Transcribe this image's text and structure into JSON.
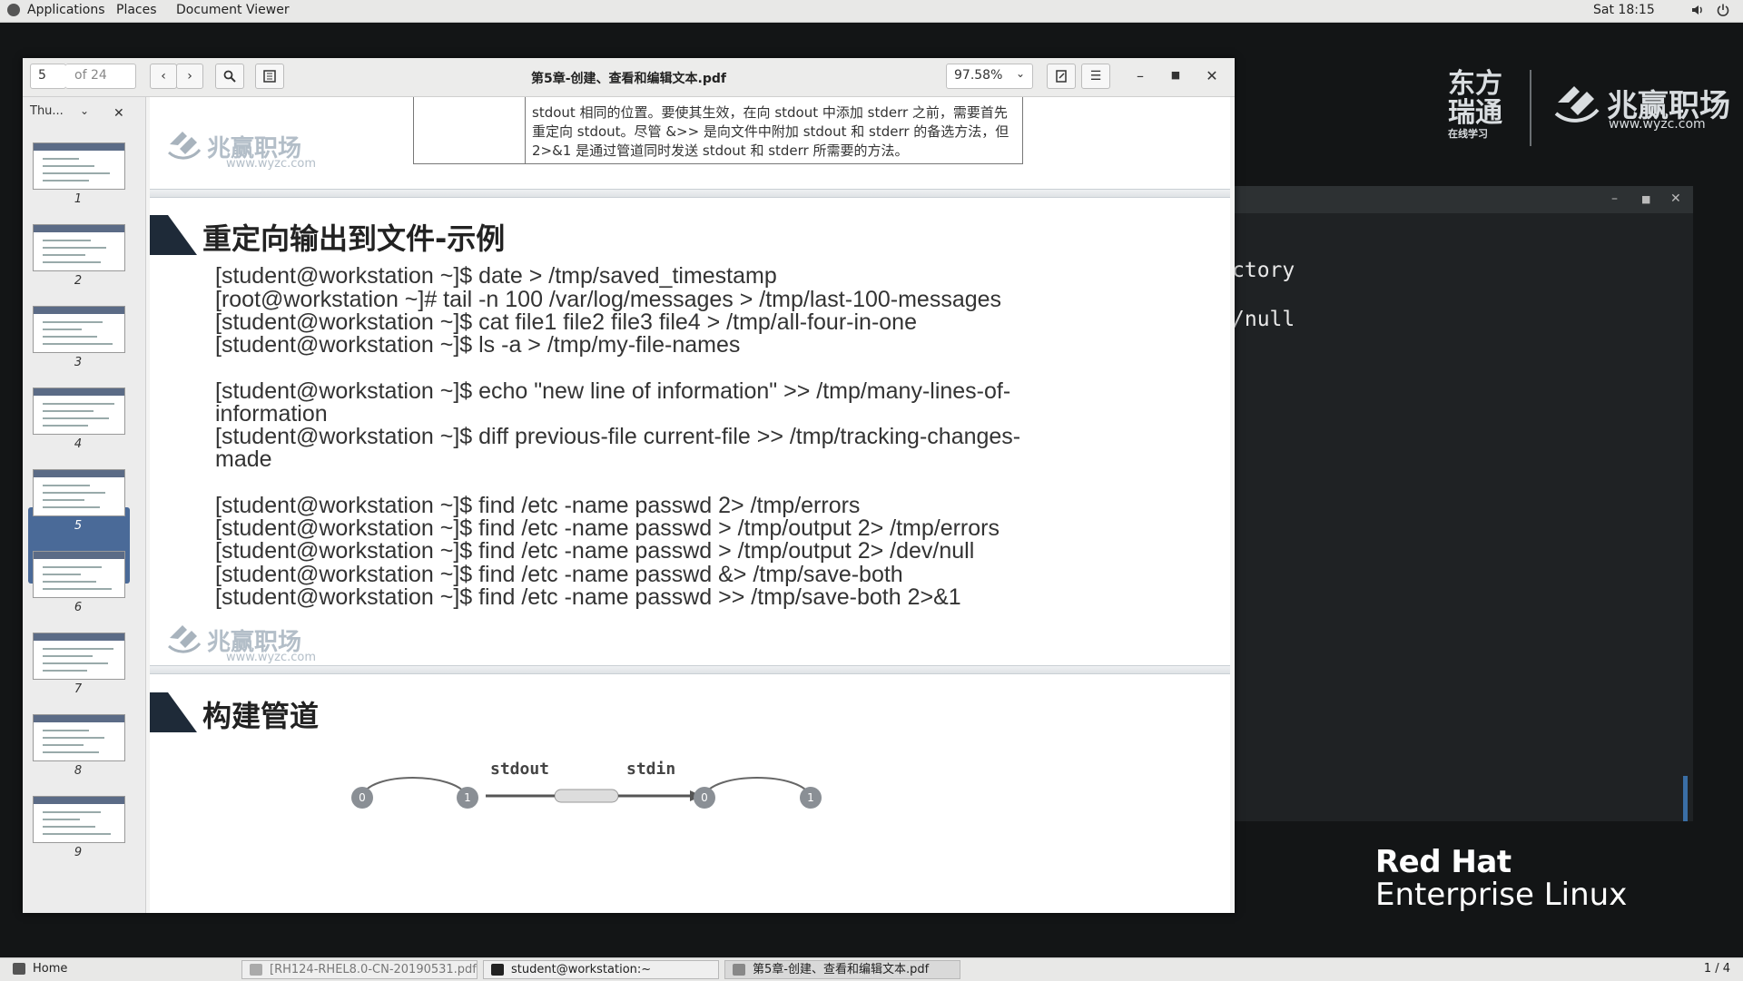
{
  "topbar": {
    "applications": "Applications",
    "places": "Places",
    "app_name": "Document Viewer",
    "clock": "Sat 18:15"
  },
  "terminal": {
    "lines": [
      "ctory",
      "/null"
    ]
  },
  "logos": {
    "logo1_main": "东方\n瑞通",
    "logo1_sub": "在线学习",
    "logo2_name": "兆赢职场",
    "logo2_url": "www.wyzc.com",
    "redhat_line1": "Red Hat",
    "redhat_line2": "Enterprise Linux"
  },
  "viewer": {
    "page_input": "5",
    "page_total": "of 24",
    "title": "第5章-创建、查看和编辑文本.pdf",
    "zoom": "97.58%",
    "sidebar_select": "Thu...",
    "thumb_numbers": [
      "1",
      "2",
      "3",
      "4",
      "5",
      "6",
      "7",
      "8",
      "9"
    ],
    "selected_page": 5
  },
  "page": {
    "note_lines": [
      "stdout 相同的位置。要使其生效，在向 stdout 中添加 stderr 之前，需要首先",
      "重定向 stdout。尽管 &>> 是向文件中附加 stdout 和 stderr 的备选方法，但",
      "2>&1 是通过管道同时发送 stdout 和 stderr 所需要的方法。"
    ],
    "watermark_name": "兆赢职场",
    "watermark_url": "www.wyzc.com",
    "section1_title": "重定向输出到文件-示例",
    "code_lines": [
      "[student@workstation ~]$ date > /tmp/saved_timestamp",
      "[root@workstation ~]# tail -n 100 /var/log/messages > /tmp/last-100-messages",
      "[student@workstation ~]$ cat file1 file2 file3 file4 > /tmp/all-four-in-one",
      "[student@workstation ~]$ ls -a > /tmp/my-file-names",
      "[student@workstation ~]$ echo \"new line of information\" >> /tmp/many-lines-of-",
      "information",
      "[student@workstation ~]$ diff previous-file current-file >> /tmp/tracking-changes-",
      "made",
      "[student@workstation ~]$ find /etc -name passwd 2> /tmp/errors",
      "[student@workstation ~]$ find /etc -name passwd > /tmp/output 2> /tmp/errors",
      "[student@workstation ~]$ find /etc -name passwd > /tmp/output 2> /dev/null",
      "[student@workstation ~]$ find /etc -name passwd &> /tmp/save-both",
      "[student@workstation ~]$ find /etc -name passwd >> /tmp/save-both 2>&1"
    ],
    "section2_title": "构建管道",
    "diagram": {
      "stdout_label": "stdout",
      "stdin_label": "stdin",
      "node_labels": [
        "0",
        "1",
        "0",
        "1"
      ]
    }
  },
  "taskbar": {
    "home": "Home",
    "task1": "[RH124-RHEL8.0-CN-20190531.pdf]",
    "task2": "student@workstation:~",
    "task3": "第5章-创建、查看和编辑文本.pdf",
    "workspace": "1 / 4"
  }
}
